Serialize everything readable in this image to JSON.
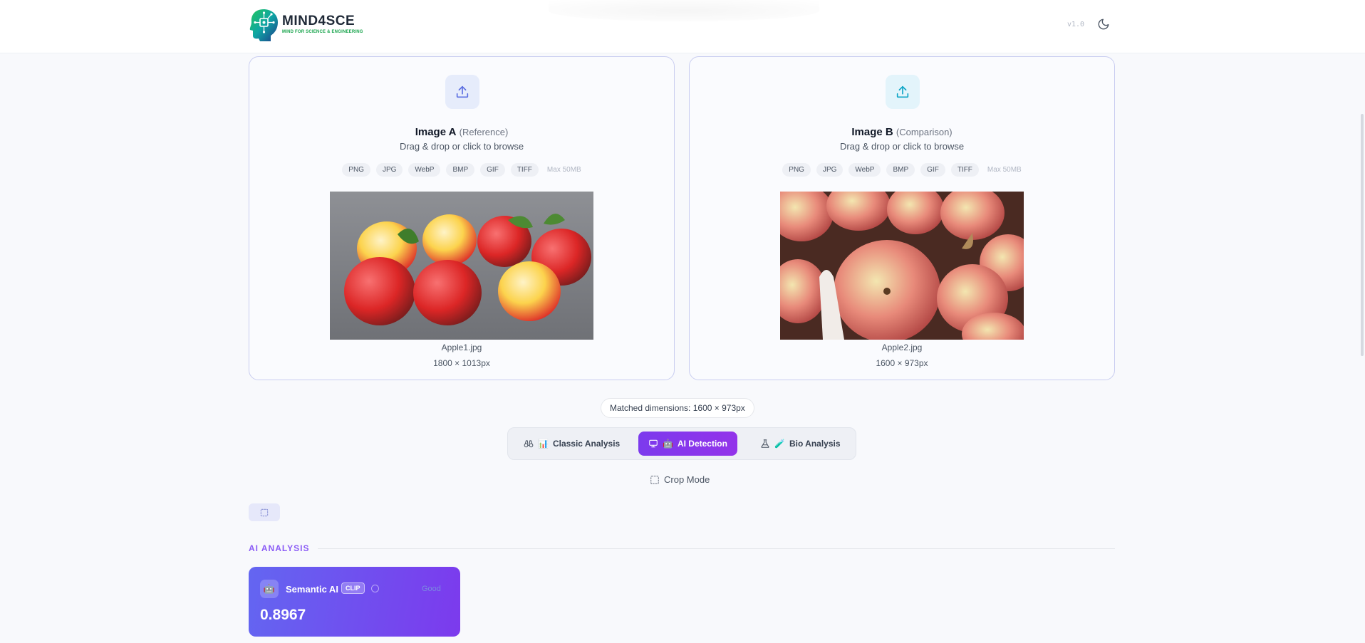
{
  "header": {
    "brand_title": "MIND4SCE",
    "brand_subtitle": "MIND FOR SCIENCE & ENGINEERING",
    "version": "v1.0",
    "theme_icon": "moon-icon"
  },
  "image_a": {
    "title": "Image A",
    "role": "(Reference)",
    "hint": "Drag & drop or click to browse",
    "formats": [
      "PNG",
      "JPG",
      "WebP",
      "BMP",
      "GIF",
      "TIFF"
    ],
    "max_size": "Max 50MB",
    "filename": "Apple1.jpg",
    "dimensions": "1800 × 1013px",
    "icon": "upload-icon"
  },
  "image_b": {
    "title": "Image B",
    "role": "(Comparison)",
    "hint": "Drag & drop or click to browse",
    "formats": [
      "PNG",
      "JPG",
      "WebP",
      "BMP",
      "GIF",
      "TIFF"
    ],
    "max_size": "Max 50MB",
    "filename": "Apple2.jpg",
    "dimensions": "1600 × 973px",
    "icon": "upload-icon"
  },
  "matched_dimensions": "Matched dimensions: 1600 × 973px",
  "modes": {
    "classic": {
      "label": "Classic Analysis",
      "emoji": "📊"
    },
    "ai": {
      "label": "AI Detection",
      "emoji": "🤖",
      "active": true
    },
    "bio": {
      "label": "Bio Analysis",
      "emoji": "🧪"
    }
  },
  "crop_mode": "Crop Mode",
  "section_title": "AI ANALYSIS",
  "ai_card": {
    "avatar": "🤖",
    "name": "Semantic AI",
    "badge": "CLIP",
    "status": "Good",
    "score": "0.8967"
  },
  "colors": {
    "accent": "#7c3aed",
    "accent_gradient_start": "#6366f1",
    "card_border": "#c9cdf0",
    "section_title": "#8b5cf6"
  }
}
